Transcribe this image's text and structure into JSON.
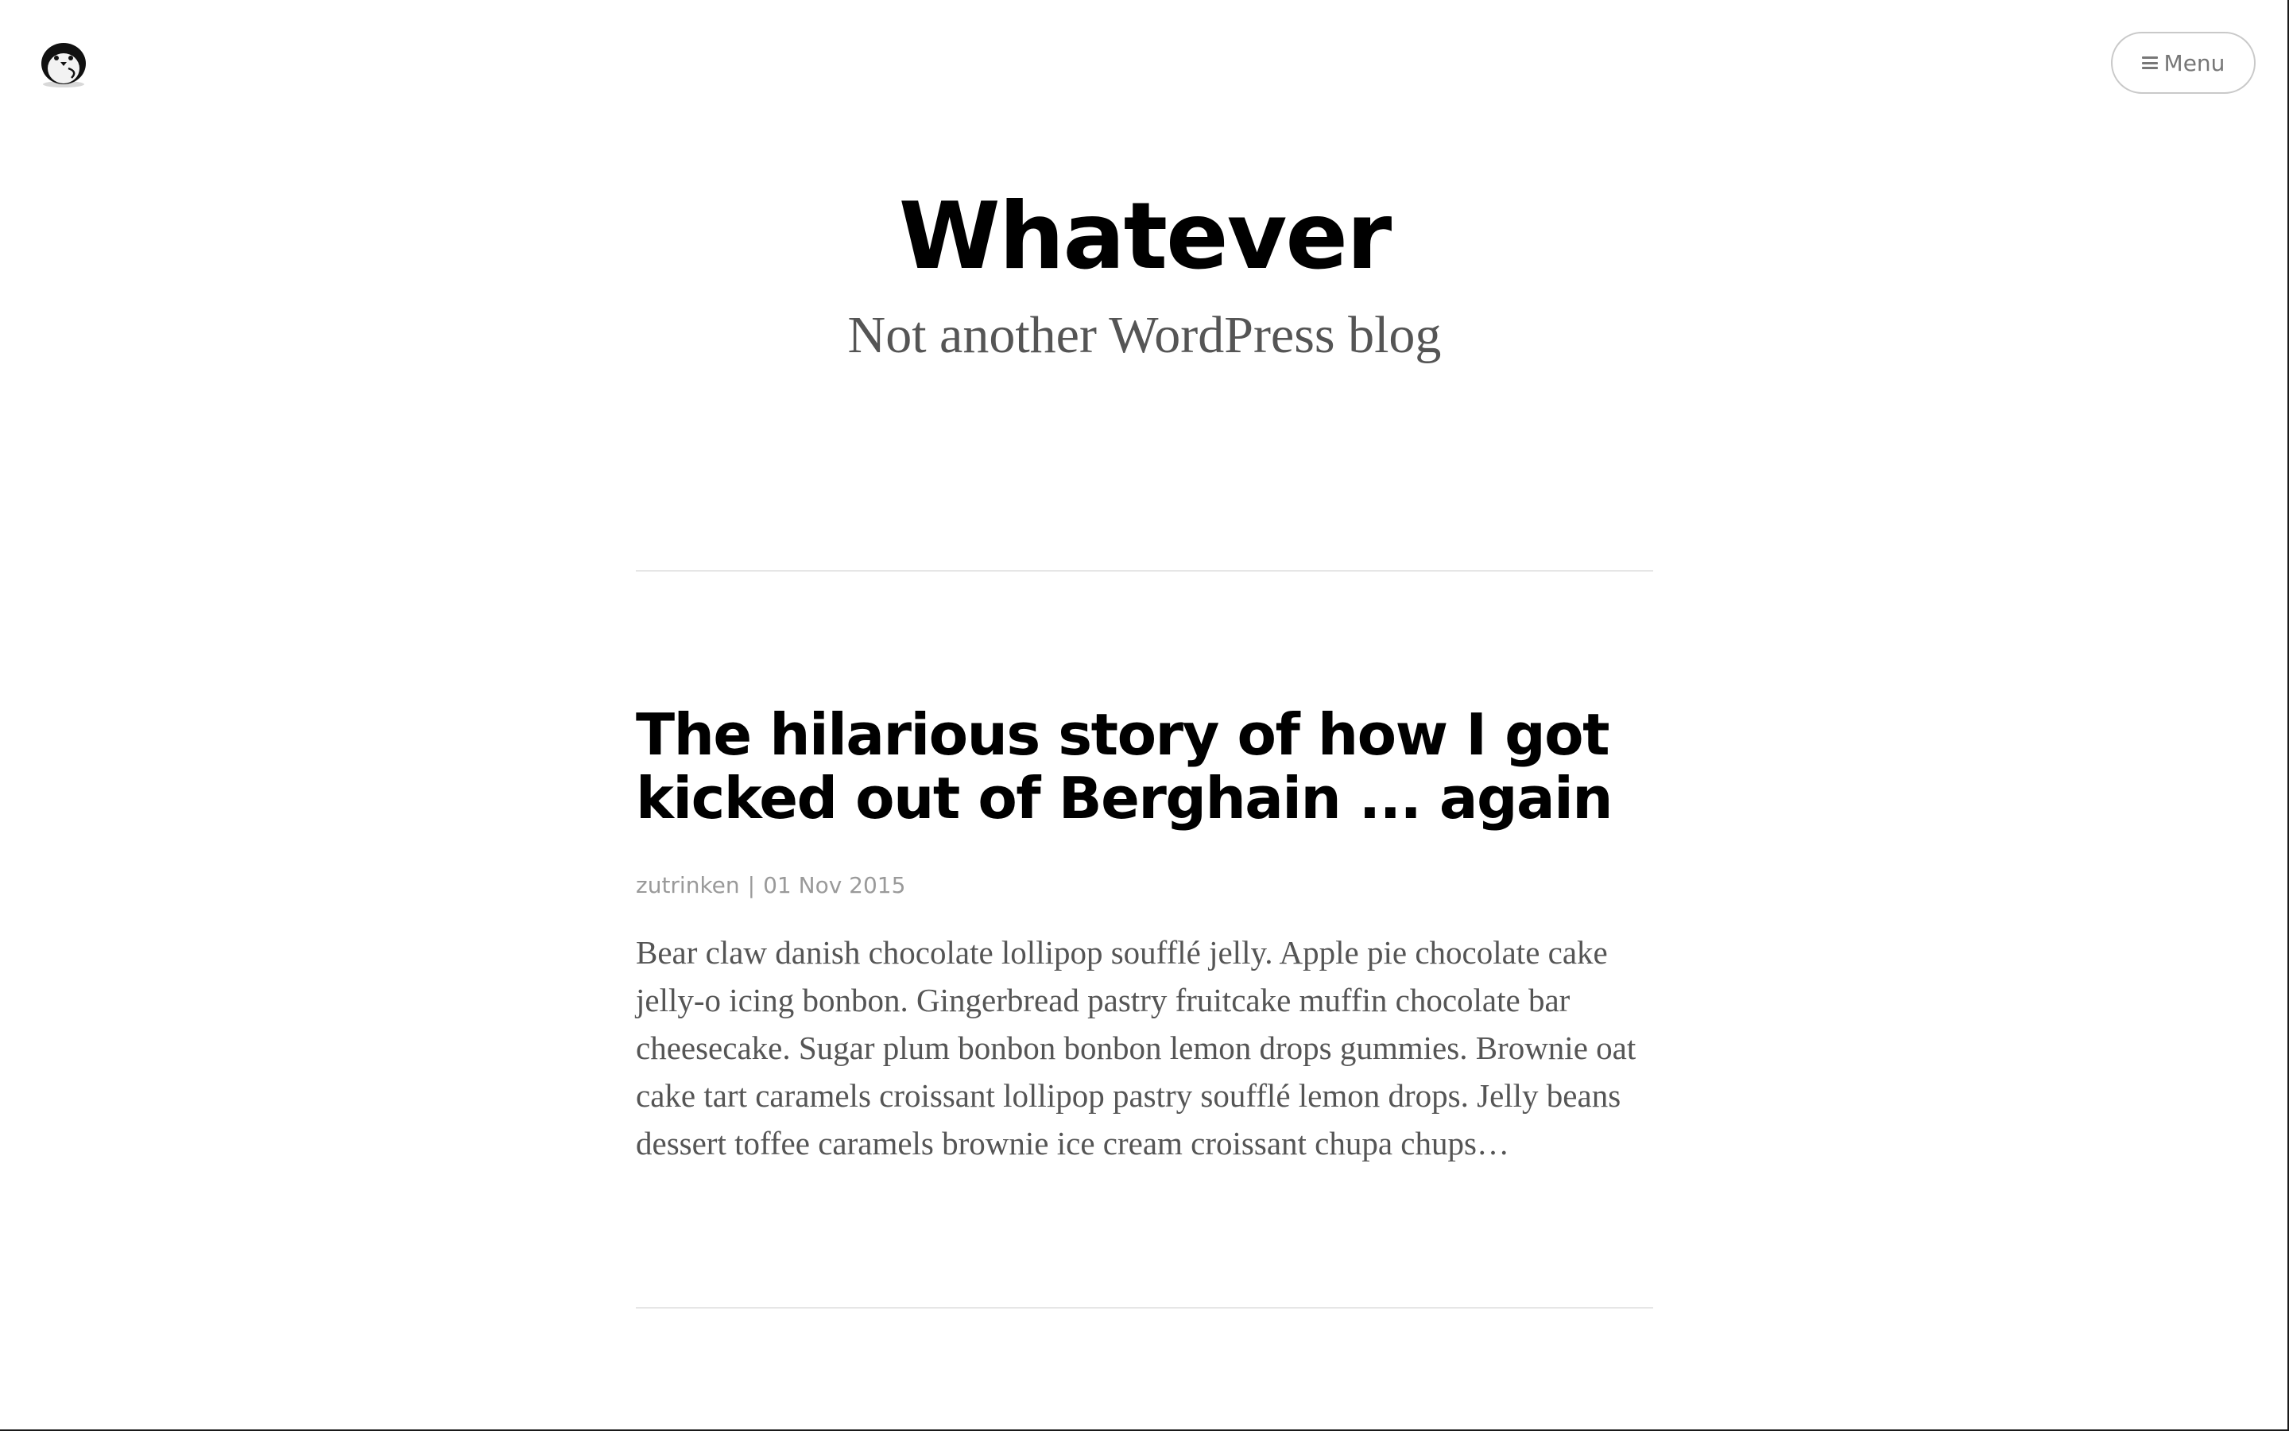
{
  "header": {
    "logo_icon": "penguin-icon",
    "menu_icon": "hamburger-icon",
    "menu_label": "Menu"
  },
  "site": {
    "title": "Whatever",
    "tagline": "Not another WordPress blog"
  },
  "posts": [
    {
      "title": "The hilarious story of how I got kicked out of Berghain ... again",
      "author": "zutrinken",
      "separator": "|",
      "date": "01 Nov 2015",
      "excerpt": "Bear claw danish chocolate lollipop soufflé jelly. Apple pie chocolate cake jelly-o icing bonbon. Gingerbread pastry fruitcake muffin chocolate bar cheesecake. Sugar plum bonbon bonbon lemon drops gummies. Brownie oat cake tart caramels croissant lollipop pastry soufflé lemon drops. Jelly beans dessert toffee caramels brownie ice cream croissant chupa chups…"
    }
  ],
  "colors": {
    "background": "#ffffff",
    "title": "#000000",
    "tagline": "#555555",
    "meta": "#9a9a9a",
    "divider": "#e6e6e6",
    "button_border": "#c9c9c9"
  }
}
